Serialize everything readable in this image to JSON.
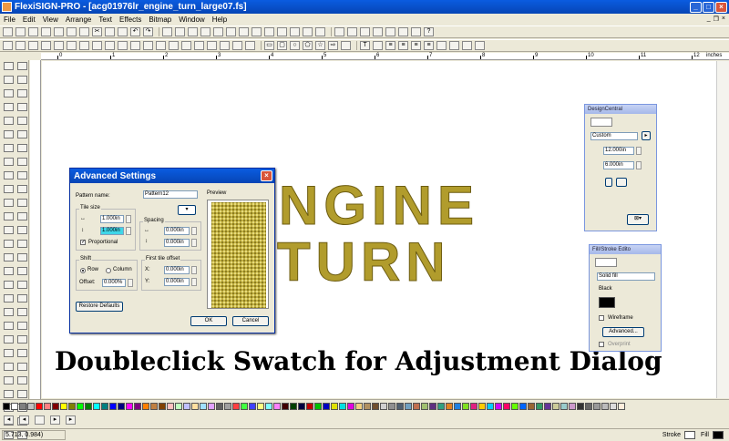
{
  "app": {
    "title": "FlexiSIGN-PRO - [acg01976lr_engine_turn_large07.fs]"
  },
  "menu": [
    "File",
    "Edit",
    "View",
    "Arrange",
    "Text",
    "Effects",
    "Bitmap",
    "Window",
    "Help"
  ],
  "ruler": {
    "unit": "inches",
    "ticks": [
      "0",
      "1",
      "2",
      "3",
      "4",
      "5",
      "6",
      "7",
      "8",
      "9",
      "10",
      "11",
      "12"
    ]
  },
  "canvas": {
    "line1": "NGINE",
    "line2": "TURN",
    "caption": "Doubleclick Swatch for Adjustment Dialog"
  },
  "dialog": {
    "title": "Advanced Settings",
    "pattern_name_label": "Pattern name:",
    "pattern_name_value": "Pattern12",
    "preview_label": "Preview",
    "tile_size_label": "Tile size",
    "tile_width": "1.000in",
    "tile_height": "1.000in",
    "proportional_label": "Proportional",
    "spacing_label": "Spacing",
    "spacing_h": "0.000in",
    "spacing_v": "0.000in",
    "shift_label": "Shift",
    "row_label": "Row",
    "column_label": "Column",
    "offset_label": "Offset:",
    "offset_value": "0.000%",
    "first_tile_label": "First tile offset",
    "x_label": "X:",
    "y_label": "Y:",
    "x_value": "0.000in",
    "y_value": "0.000in",
    "restore_label": "Restore Defaults",
    "ok_label": "OK",
    "cancel_label": "Cancel"
  },
  "design_central": {
    "title": "DesignCentral",
    "preset": "Custom",
    "width": "12.000in",
    "height": "6.000in"
  },
  "fill_stroke": {
    "title": "Fill/Stroke Edito",
    "fill_type": "Solid fill",
    "color_name": "Black",
    "wireframe_label": "Wireframe",
    "advanced_label": "Advanced...",
    "overprint_label": "Overprint"
  },
  "palette_colors": [
    "#000000",
    "#ffffff",
    "#808080",
    "#c0c0c0",
    "#ff0000",
    "#ff8080",
    "#800000",
    "#ffff00",
    "#808000",
    "#00ff00",
    "#008000",
    "#00ffff",
    "#008080",
    "#0000ff",
    "#000080",
    "#ff00ff",
    "#800080",
    "#ff8000",
    "#c08040",
    "#804000",
    "#ffc0c0",
    "#c0ffc0",
    "#c0c0ff",
    "#ffe0a0",
    "#a0e0ff",
    "#e0a0ff",
    "#606060",
    "#a0a0a0",
    "#ff4040",
    "#40ff40",
    "#4040ff",
    "#ffff80",
    "#80ffff",
    "#ff80ff",
    "#400000",
    "#004000",
    "#000040",
    "#c00000",
    "#00c000",
    "#0000c0",
    "#e0e000",
    "#00e0e0",
    "#e000e0",
    "#f0d080",
    "#b09060",
    "#705030",
    "#d0d0d0",
    "#909090",
    "#506070",
    "#70a0c0",
    "#c07050",
    "#a0c070",
    "#603080",
    "#30a080",
    "#e08020",
    "#2080e0",
    "#80e020",
    "#e02080",
    "#ffcc00",
    "#00ccff",
    "#cc00ff",
    "#ff0066",
    "#66ff00",
    "#0066ff",
    "#996633",
    "#339966",
    "#663399",
    "#cccc99",
    "#99cccc",
    "#cc99cc",
    "#333333",
    "#666666",
    "#999999",
    "#bbbbbb",
    "#dddddd",
    "#ffeedd"
  ],
  "status": {
    "coords": "5.713,    0.984)",
    "stroke_label": "Stroke",
    "fill_label": "Fill"
  },
  "colors": {
    "pattern_gold": "#b19c2c",
    "titlebar_blue": "#0a5ce0"
  }
}
